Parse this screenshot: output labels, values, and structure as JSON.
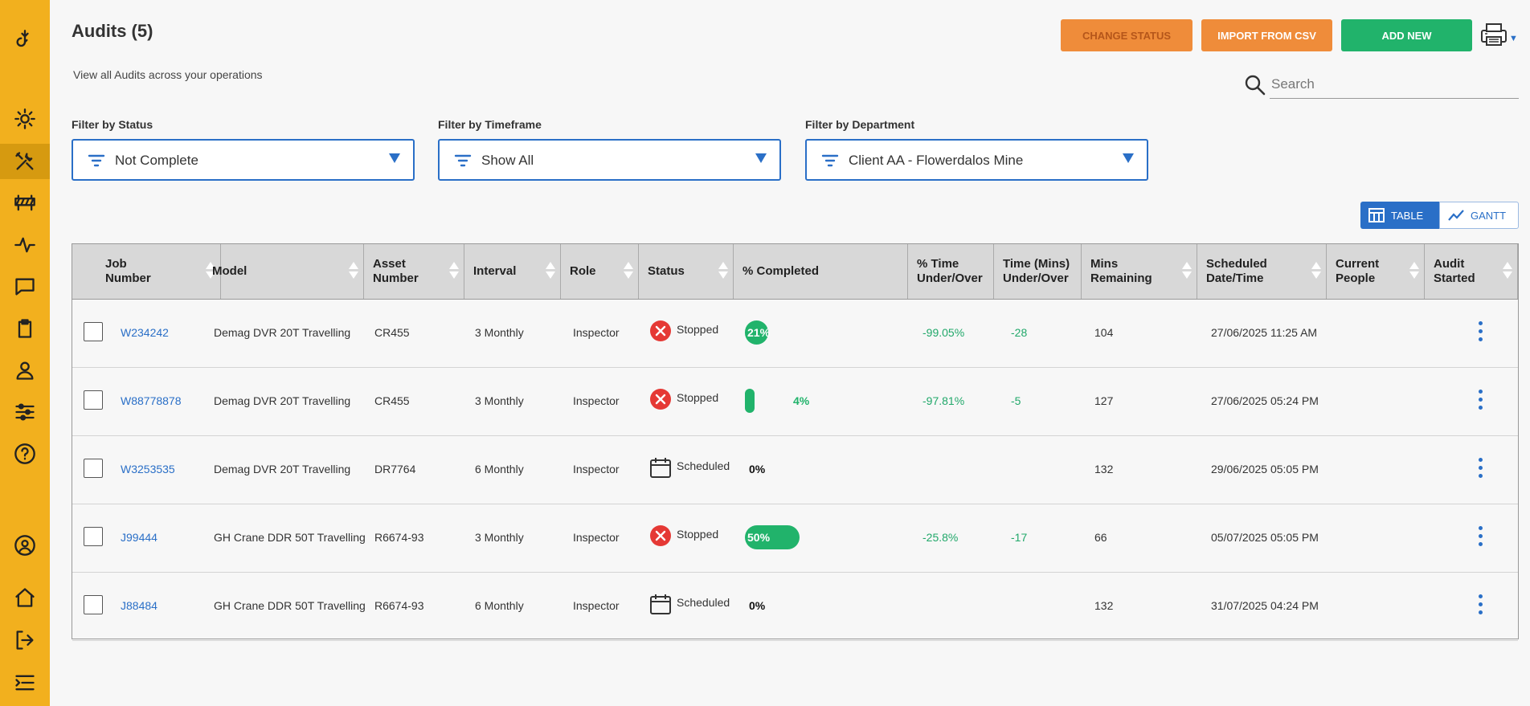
{
  "sidebar": {
    "icons": [
      "logo-hook-icon",
      "dashboard-gear-icon",
      "tools-icon",
      "barrier-icon",
      "activity-icon",
      "chat-icon",
      "clipboard-icon",
      "person-icon",
      "sliders-icon",
      "help-icon",
      "profile-icon",
      "home-icon",
      "logout-icon",
      "menu-collapse-icon"
    ],
    "active": "tools-icon",
    "color": "#f2b01e"
  },
  "header": {
    "title": "Audits (5)",
    "subtitle": "View all Audits across your operations",
    "buttons": {
      "change_status": "CHANGE STATUS",
      "import_csv": "IMPORT FROM CSV",
      "add_new": "ADD NEW"
    },
    "search_placeholder": "Search"
  },
  "filters": {
    "status": {
      "label": "Filter by Status",
      "value": "Not Complete"
    },
    "timeframe": {
      "label": "Filter by Timeframe",
      "value": "Show All"
    },
    "department": {
      "label": "Filter by Department",
      "value": "Client AA - Flowerdalos Mine"
    }
  },
  "view_toggle": {
    "table": "TABLE",
    "gantt": "GANTT",
    "selected": "TABLE"
  },
  "table": {
    "columns": [
      {
        "label": "Job Number",
        "line1": "Job",
        "line2": "Number",
        "sortable": true
      },
      {
        "label": "Model",
        "line1": "Model",
        "line2": "",
        "sortable": true
      },
      {
        "label": "Asset Number",
        "line1": "Asset",
        "line2": "Number",
        "sortable": true
      },
      {
        "label": "Interval",
        "line1": "Interval",
        "line2": "",
        "sortable": true
      },
      {
        "label": "Role",
        "line1": "Role",
        "line2": "",
        "sortable": true
      },
      {
        "label": "Status",
        "line1": "Status",
        "line2": "",
        "sortable": true
      },
      {
        "label": "% Completed",
        "line1": "% Completed",
        "line2": "",
        "sortable": false
      },
      {
        "label": "% Time Under/Over",
        "line1": "% Time",
        "line2": "Under/Over",
        "sortable": false
      },
      {
        "label": "Time (Mins) Under/Over",
        "line1": "Time (Mins)",
        "line2": "Under/Over",
        "sortable": false
      },
      {
        "label": "Mins Remaining",
        "line1": "Mins",
        "line2": "Remaining",
        "sortable": true
      },
      {
        "label": "Scheduled Date/Time",
        "line1": "Scheduled",
        "line2": "Date/Time",
        "sortable": true
      },
      {
        "label": "Current People",
        "line1": "Current",
        "line2": "People",
        "sortable": true
      },
      {
        "label": "Audit Started",
        "line1": "Audit",
        "line2": "Started",
        "sortable": true
      }
    ],
    "rows": [
      {
        "job": "W234242",
        "model": "Demag DVR 20T Travelling",
        "asset": "CR455",
        "interval": "3 Monthly",
        "role": "Inspector",
        "status": "Stopped",
        "status_icon": "stopped-x-icon",
        "percent": 21,
        "percent_label": "21%",
        "time_pct": "-99.05%",
        "time_mins": "-28",
        "mins_remaining": "104",
        "scheduled": "27/06/2025 11:25 AM",
        "current_people": "",
        "audit_started": ""
      },
      {
        "job": "W88778878",
        "model": "Demag DVR 20T Travelling",
        "asset": "CR455",
        "interval": "3 Monthly",
        "role": "Inspector",
        "status": "Stopped",
        "status_icon": "stopped-x-icon",
        "percent": 4,
        "percent_label": "4%",
        "time_pct": "-97.81%",
        "time_mins": "-5",
        "mins_remaining": "127",
        "scheduled": "27/06/2025 05:24 PM",
        "current_people": "",
        "audit_started": ""
      },
      {
        "job": "W3253535",
        "model": "Demag DVR 20T Travelling",
        "asset": "DR7764",
        "interval": "6 Monthly",
        "role": "Inspector",
        "status": "Scheduled",
        "status_icon": "calendar-icon",
        "percent": 0,
        "percent_label": "0%",
        "time_pct": "",
        "time_mins": "",
        "mins_remaining": "132",
        "scheduled": "29/06/2025 05:05 PM",
        "current_people": "",
        "audit_started": ""
      },
      {
        "job": "J99444",
        "model": "GH Crane DDR 50T Travelling",
        "asset": "R6674-93",
        "interval": "3 Monthly",
        "role": "Inspector",
        "status": "Stopped",
        "status_icon": "stopped-x-icon",
        "percent": 50,
        "percent_label": "50%",
        "time_pct": "-25.8%",
        "time_mins": "-17",
        "mins_remaining": "66",
        "scheduled": "05/07/2025 05:05 PM",
        "current_people": "",
        "audit_started": ""
      },
      {
        "job": "J88484",
        "model": "GH Crane DDR 50T Travelling",
        "asset": "R6674-93",
        "interval": "6 Monthly",
        "role": "Inspector",
        "status": "Scheduled",
        "status_icon": "calendar-icon",
        "percent": 0,
        "percent_label": "0%",
        "time_pct": "",
        "time_mins": "",
        "mins_remaining": "132",
        "scheduled": "31/07/2025 04:24 PM",
        "current_people": "",
        "audit_started": ""
      }
    ]
  },
  "colors": {
    "accent_blue": "#2a6fc7",
    "orange": "#ef8c3a",
    "green": "#21b36b",
    "stopped_red": "#e53935"
  }
}
